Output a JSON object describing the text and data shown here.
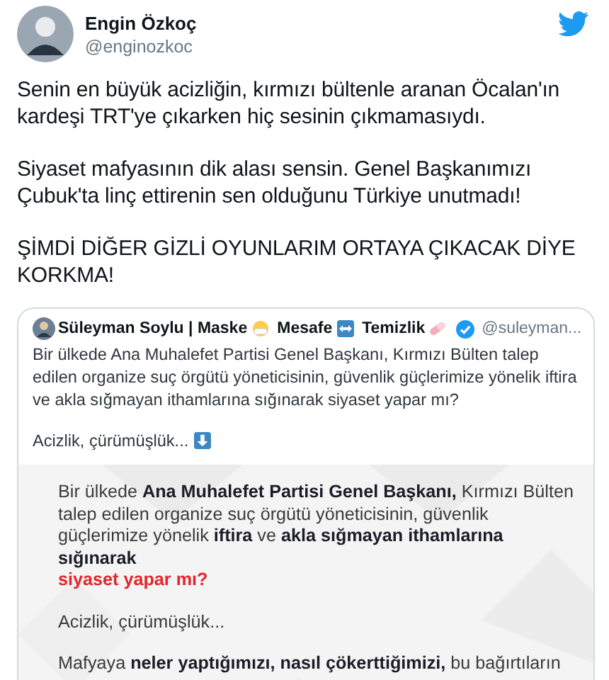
{
  "author": {
    "name": "Engin Özkoç",
    "handle": "@enginozkoc"
  },
  "paragraphs": [
    "Senin en büyük acizliğin, kırmızı bültenle aranan Öcalan'ın kardeşi TRT'ye çıkarken hiç sesinin çıkmamasıydı.",
    "Siyaset mafyasının dik alası sensin. Genel Başkanımızı Çubuk'ta linç ettirenin sen olduğunu Türkiye unutmadı!",
    "ŞİMDİ DİĞER GİZLİ OYUNLARIM ORTAYA ÇIKACAK DİYE KORKMA!"
  ],
  "quote": {
    "name_parts": [
      {
        "kind": "text",
        "text": "Süleyman Soylu | Maske"
      },
      {
        "kind": "mask"
      },
      {
        "kind": "text",
        "text": "Mesafe"
      },
      {
        "kind": "arrows"
      },
      {
        "kind": "text",
        "text": "Temizlik"
      },
      {
        "kind": "pill"
      }
    ],
    "verified": true,
    "handle": "@suleyman...",
    "text": "Bir ülkede Ana Muhalefet Partisi Genel Başkanı, Kırmızı Bülten talep edilen organize suç örgütü yöneticisinin, güvenlik güçlerimize yönelik iftira ve akla sığmayan ithamlarına sığınarak siyaset yapar mı?",
    "tail": "Acizlik, çürümüşlük...",
    "image": {
      "lines": [
        {
          "kind": "body",
          "text": "Bir ülkede **Ana Muhalefet Partisi Genel Başkanı,** Kırmızı Bülten talep edilen organize suç örgütü yöneticisinin, güvenlik güçlerimize yönelik **iftira** ve **akla sığmayan ithamlarına sığınarak**"
        },
        {
          "kind": "highlight",
          "text": "siyaset yapar mı?"
        },
        {
          "kind": "body",
          "text": "Acizlik, çürümüşlük..."
        },
        {
          "kind": "body",
          "text": "Mafyaya **neler yaptığımızı, nasıl çökerttiğimizi,** bu bağırtıların"
        }
      ]
    }
  }
}
